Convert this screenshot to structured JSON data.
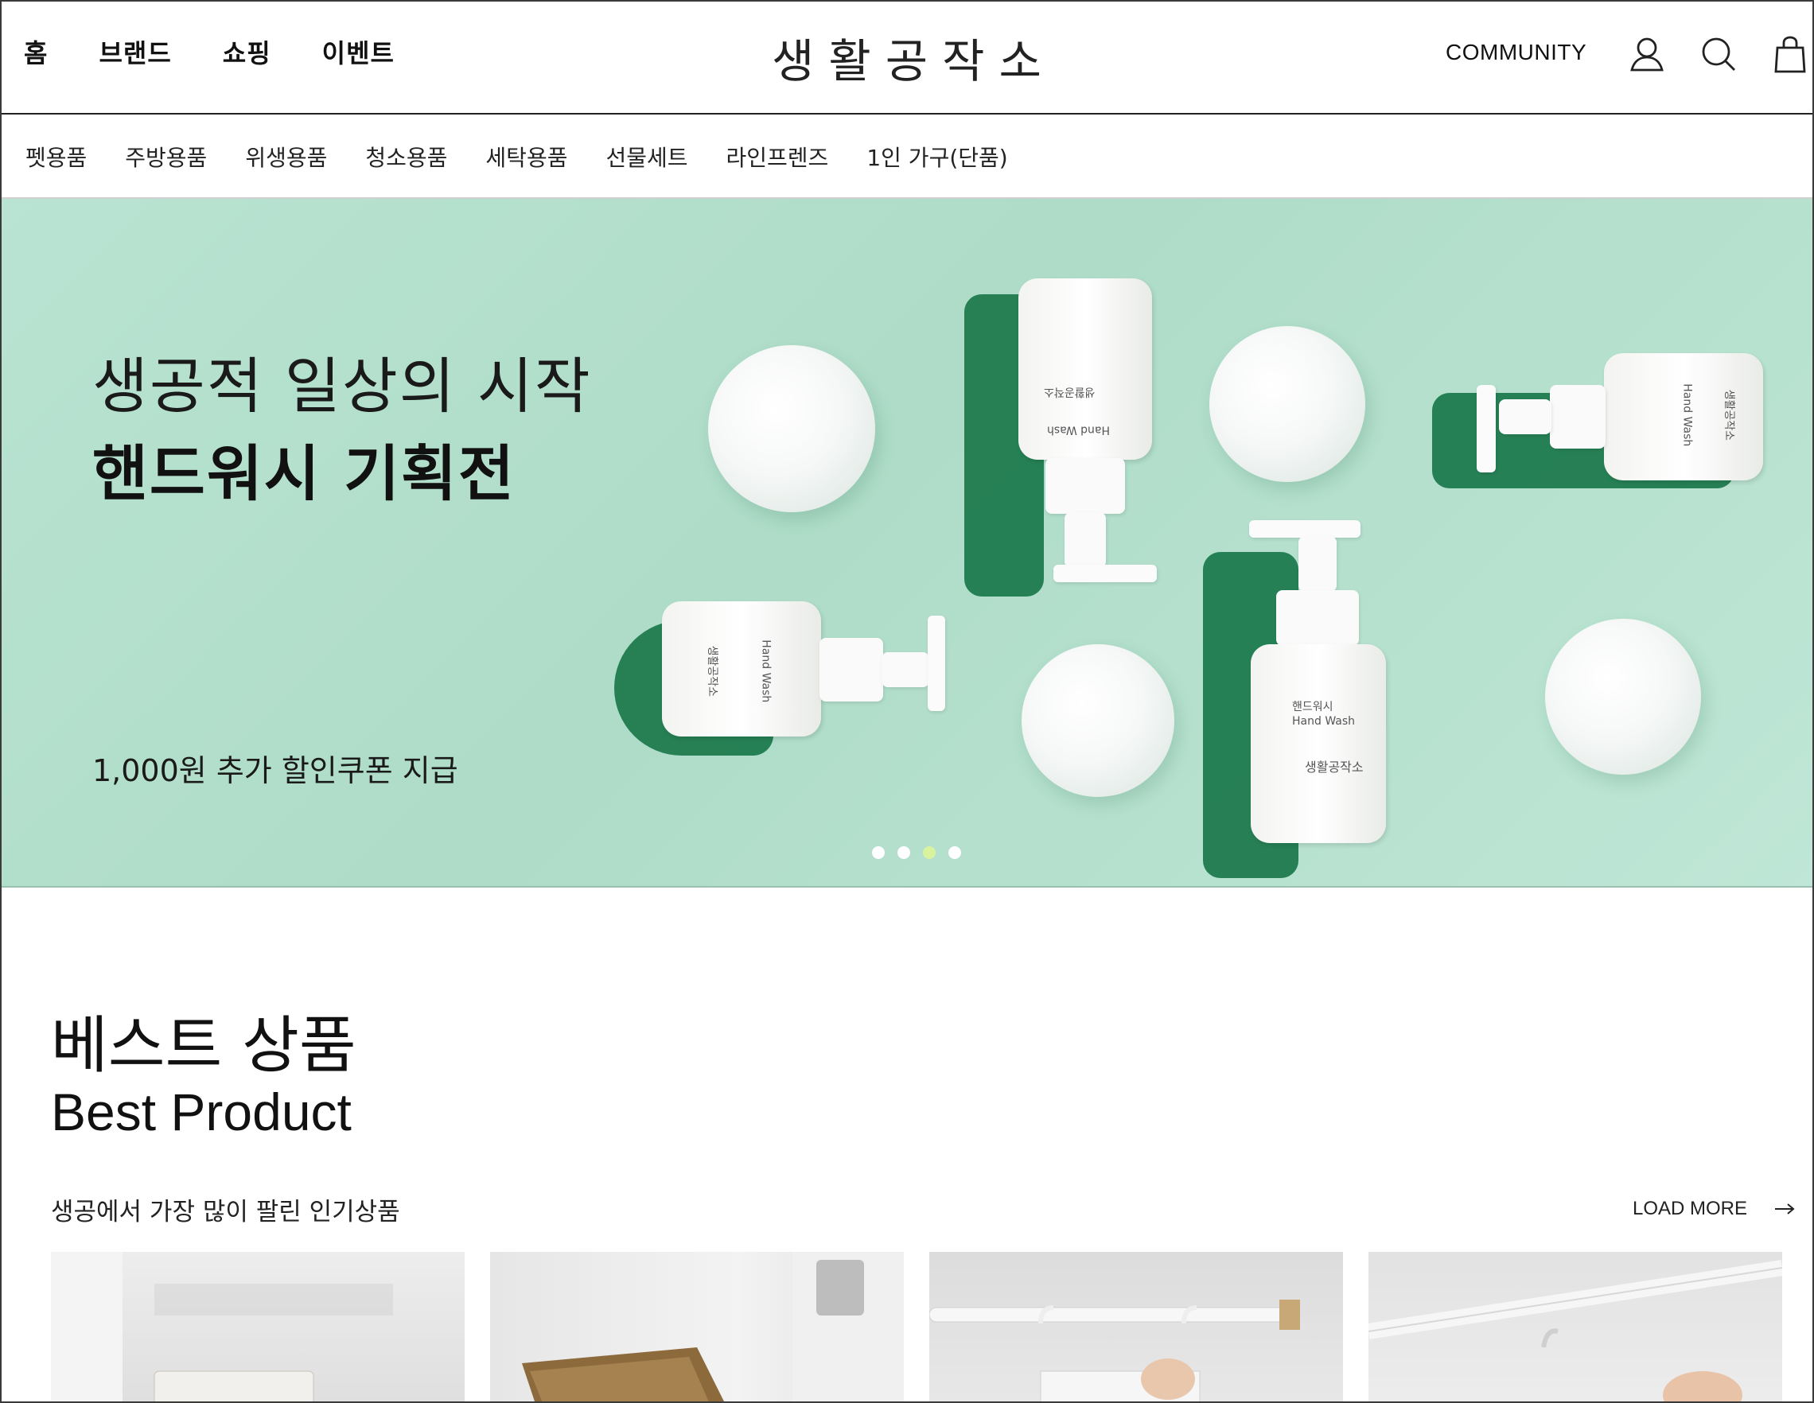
{
  "header": {
    "nav": [
      "홈",
      "브랜드",
      "쇼핑",
      "이벤트"
    ],
    "logo": "생활공작소",
    "community": "COMMUNITY",
    "icons": [
      "user-icon",
      "search-icon",
      "bag-icon"
    ]
  },
  "categories": [
    "펫용품",
    "주방용품",
    "위생용품",
    "청소용품",
    "세탁용품",
    "선물세트",
    "라인프렌즈",
    "1인 가구(단품)"
  ],
  "hero": {
    "subtitle": "생공적 일상의 시작",
    "title": "핸드워시 기획전",
    "coupon": "1,000원 추가 할인쿠폰 지급",
    "bottle_label_ko": "핸드워시",
    "bottle_label_en": "Hand Wash",
    "bottle_brand": "생활공작소",
    "slides": 4,
    "active_slide": 3,
    "background_color": "#b3e0cd"
  },
  "best": {
    "title_ko": "베스트 상품",
    "title_en": "Best Product",
    "description": "생공에서 가장 많이 팔린 인기상품",
    "load_more": "LOAD MORE"
  },
  "products": [
    {
      "image": "product-1-image"
    },
    {
      "image": "product-2-image"
    },
    {
      "image": "product-3-image"
    },
    {
      "image": "product-4-image"
    }
  ]
}
